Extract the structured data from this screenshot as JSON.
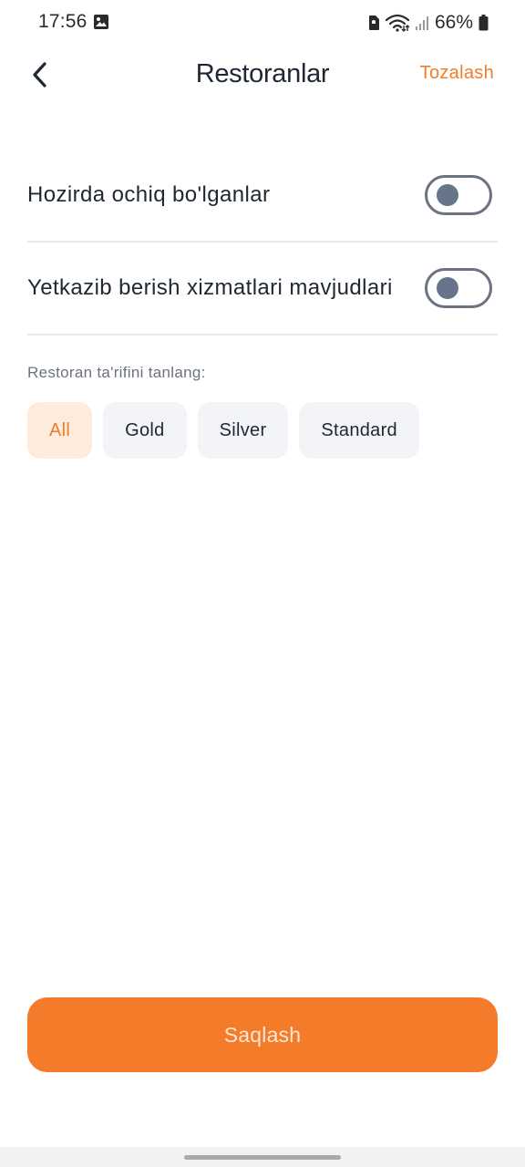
{
  "status_bar": {
    "time": "17:56",
    "battery_percent": "66%",
    "icons": [
      "gallery-icon",
      "sim-icon",
      "wifi-icon",
      "signal-icon",
      "battery-icon"
    ]
  },
  "header": {
    "back_icon": "chevron-left-icon",
    "title": "Restoranlar",
    "clear_label": "Tozalash"
  },
  "filters": {
    "open_now": {
      "label": "Hozirda ochiq bo'lganlar",
      "enabled": false
    },
    "delivery": {
      "label": "Yetkazib berish xizmatlari mavjudlari",
      "enabled": false
    }
  },
  "tier": {
    "label": "Restoran ta'rifini tanlang:",
    "options": [
      "All",
      "Gold",
      "Silver",
      "Standard"
    ],
    "selected": "All"
  },
  "footer": {
    "save_label": "Saqlash"
  },
  "colors": {
    "accent": "#f47b2a",
    "accent_text": "#ef7d2a",
    "chip_active_bg": "#fdebdd",
    "chip_bg": "#f2f4f7",
    "title": "#1f2733",
    "muted": "#6b7280",
    "toggle_knob": "#67758a"
  }
}
